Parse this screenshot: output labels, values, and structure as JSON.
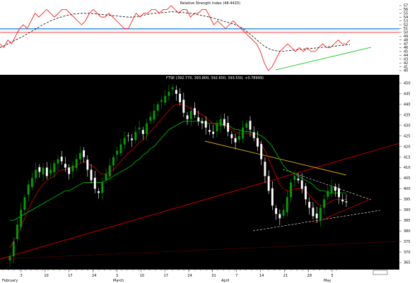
{
  "rsi_panel": {
    "title": "Relative Strength Index (48.4420)",
    "tick_labels": [
      "57",
      "56",
      "55",
      "54",
      "53",
      "52",
      "51",
      "50",
      "49",
      "48",
      "47",
      "46",
      "45",
      "44",
      "43",
      "42",
      "41",
      "40"
    ],
    "ylim": [
      40,
      57
    ],
    "upper_threshold": 51,
    "lower_threshold": 50,
    "colors": {
      "line": "#ff0000",
      "average": "#000000",
      "upper": "#0070c0",
      "lower": "#ff0000",
      "trendline": "#00c000",
      "background": "#ffffff"
    }
  },
  "price_panel": {
    "title": "FTSE (392.770, 393.800, 392.650, 393.550, +0.78999)",
    "tick_labels": [
      "450",
      "445",
      "440",
      "435",
      "430",
      "425",
      "420",
      "415",
      "410",
      "405",
      "400",
      "395",
      "390",
      "385",
      "380",
      "375",
      "370",
      "365"
    ],
    "ylim": [
      363,
      452
    ],
    "x_day_labels": [
      "3",
      "10",
      "17",
      "24",
      "3",
      "10",
      "17",
      "24",
      "31",
      "7",
      "14",
      "21",
      "28",
      "5"
    ],
    "x_month_labels": [
      "February",
      "March",
      "April",
      "May"
    ],
    "colors": {
      "background": "#000000",
      "up": "#00a000",
      "down": "#ffffff",
      "ma_fast": "#c00000",
      "ma_slow": "#00b000",
      "trend_red": "#cc0000",
      "trend_yellow": "#d4b000",
      "trend_white": "#ffffff"
    }
  },
  "chart_data": [
    {
      "type": "line",
      "title": "Relative Strength Index (48.4420)",
      "ylim": [
        40,
        57
      ],
      "series": [
        {
          "values": [
            47,
            46,
            48,
            47,
            49,
            51,
            52,
            51,
            53,
            55,
            54,
            55,
            56,
            55,
            54,
            55,
            56,
            56,
            55,
            54,
            53,
            52,
            53,
            55,
            56,
            55,
            54,
            54,
            55,
            54,
            53,
            52,
            51,
            51,
            53,
            55,
            54,
            55,
            55,
            56,
            56,
            55,
            56,
            56,
            57,
            56,
            55,
            56,
            56,
            54,
            55,
            55,
            56,
            56,
            54,
            52,
            53,
            52,
            51,
            52,
            53,
            52,
            51,
            50,
            49,
            48,
            47,
            45,
            42,
            40,
            41,
            43,
            45,
            46,
            47,
            46,
            45,
            46,
            45,
            46,
            45,
            45,
            46,
            47,
            46,
            46,
            47,
            48,
            47,
            47,
            48
          ]
        },
        {
          "values": [
            46,
            46.5,
            47,
            47.5,
            48,
            48.5,
            49,
            49.6,
            50.2,
            50.8,
            51.4,
            52,
            52.5,
            53,
            53.4,
            53.8,
            54.1,
            54.4,
            54.6,
            54.8,
            54.9,
            55,
            55,
            55,
            54.9,
            54.8,
            54.7,
            54.6,
            54.5,
            54.4,
            54.3,
            54.2,
            54.1,
            54,
            54,
            54.1,
            54.3,
            54.5,
            54.7,
            54.9,
            55,
            55.1,
            55.2,
            55.3,
            55.4,
            55.4,
            55.3,
            55.2,
            55.1,
            55,
            54.8,
            54.6,
            54.4,
            54.2,
            54,
            53.7,
            53.4,
            53.1,
            52.8,
            52.5,
            52.2,
            51.8,
            51.3,
            50.6,
            49.8,
            49,
            48.1,
            47.2,
            46.4,
            45.8,
            45.4,
            45.2,
            45.1,
            45.1,
            45.2,
            45.3,
            45.4,
            45.5,
            45.6,
            45.7,
            45.8,
            45.9,
            46,
            46.1,
            46.2,
            46.3,
            46.4,
            46.5,
            46.6,
            46.7,
            46.8
          ]
        }
      ],
      "horizontal_levels": [
        51,
        50
      ]
    },
    {
      "type": "candlestick",
      "title": "FTSE (392.770, 393.800, 392.650, 393.550, +0.78999)",
      "ylim": [
        363,
        452
      ],
      "x_tick_labels": [
        "3",
        "10",
        "17",
        "24",
        "3",
        "10",
        "17",
        "24",
        "31",
        "7",
        "14",
        "21",
        "28",
        "5"
      ],
      "close": [
        368,
        375,
        383,
        390,
        396,
        402,
        405,
        409,
        408,
        410,
        406,
        409,
        412,
        414,
        413,
        410,
        407,
        411,
        414,
        417,
        415,
        409,
        404,
        400,
        398,
        403,
        407,
        411,
        415,
        418,
        421,
        424,
        425,
        423,
        427,
        429,
        426,
        431,
        434,
        437,
        440,
        442,
        444,
        446,
        448,
        445,
        441,
        436,
        433,
        437,
        435,
        432,
        431,
        429,
        427,
        426,
        431,
        433,
        430,
        427,
        424,
        422,
        425,
        429,
        431,
        428,
        424,
        420,
        414,
        406,
        399,
        392,
        388,
        386,
        390,
        396,
        403,
        406,
        404,
        400,
        395,
        391,
        387,
        386,
        391,
        395,
        399,
        401,
        399,
        396,
        394,
        393.55
      ],
      "ma_fast": [
        372,
        375,
        378,
        382,
        386,
        390,
        394,
        397,
        400,
        402,
        404,
        405,
        406,
        408,
        409,
        409,
        410,
        410,
        411,
        412,
        413,
        412,
        411,
        410,
        408,
        407,
        407,
        408,
        409,
        411,
        413,
        415,
        417,
        418,
        420,
        422,
        423,
        425,
        427,
        429,
        431,
        433,
        435,
        437,
        439,
        440,
        440,
        440,
        439,
        438,
        437,
        436,
        435,
        434,
        432,
        431,
        430,
        430,
        430,
        429,
        428,
        427,
        426,
        426,
        426,
        426,
        425,
        423,
        421,
        418,
        414,
        410,
        406,
        402,
        400,
        399,
        399,
        400,
        400,
        400,
        399,
        397,
        395,
        393,
        392,
        392,
        393,
        394,
        395,
        395,
        395,
        395
      ],
      "ma_slow": [
        385,
        385,
        386,
        387,
        388,
        389,
        390,
        391,
        392,
        393,
        394,
        395,
        396,
        397,
        398,
        399,
        399,
        400,
        401,
        402,
        403,
        403,
        403,
        403,
        403,
        403,
        404,
        405,
        406,
        407,
        408,
        409,
        410,
        411,
        413,
        414,
        416,
        417,
        419,
        420,
        422,
        424,
        426,
        428,
        429,
        430,
        431,
        432,
        432,
        432,
        432,
        432,
        432,
        431,
        431,
        431,
        431,
        431,
        430,
        430,
        429,
        428,
        428,
        427,
        427,
        427,
        426,
        426,
        425,
        424,
        422,
        420,
        417,
        414,
        411,
        409,
        408,
        407,
        406,
        405,
        404,
        403,
        402,
        400,
        399,
        399,
        398,
        398,
        398,
        398,
        398,
        398
      ]
    }
  ]
}
